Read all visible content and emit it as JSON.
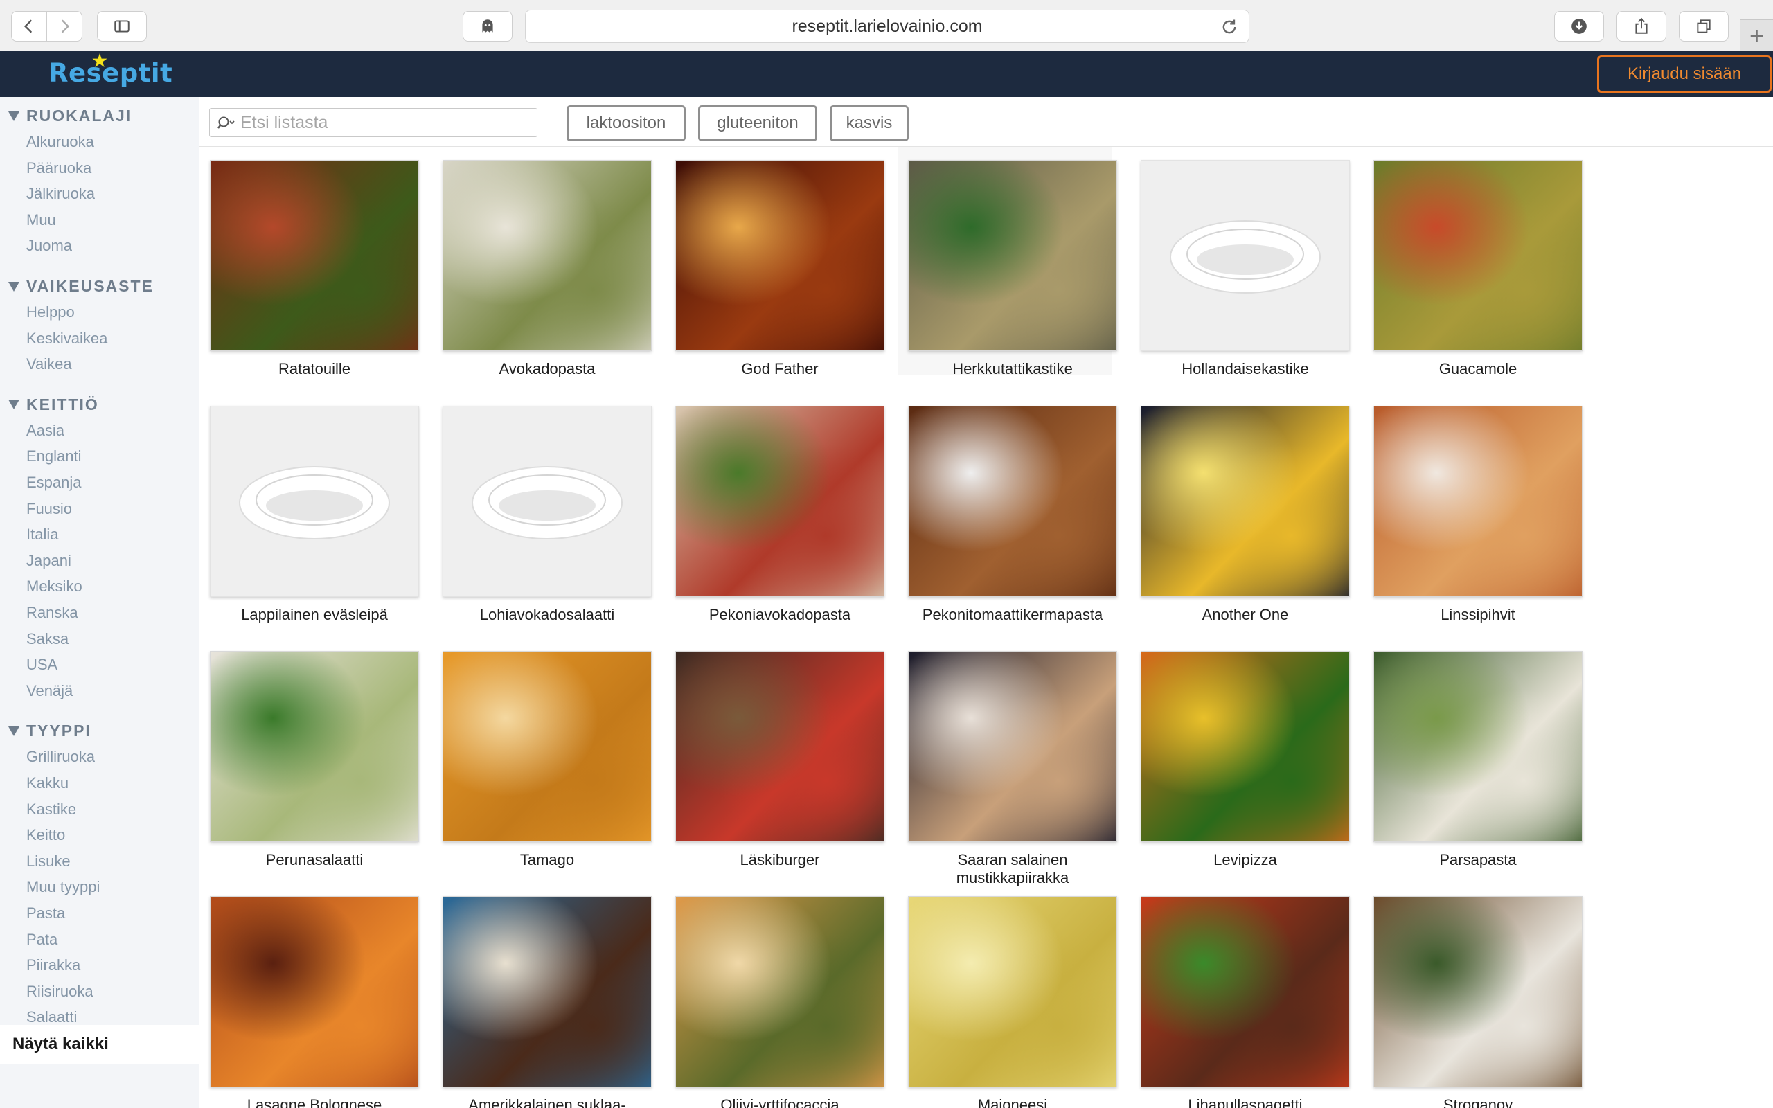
{
  "browser": {
    "url": "reseptit.larielovainio.com"
  },
  "site": {
    "logo_text": "Reseptit",
    "login_label": "Kirjaudu sisään"
  },
  "sidebar": {
    "categories": [
      {
        "heading": "RUOKALAJI",
        "items": [
          "Alkuruoka",
          "Pääruoka",
          "Jälkiruoka",
          "Muu",
          "Juoma"
        ]
      },
      {
        "heading": "VAIKEUSASTE",
        "items": [
          "Helppo",
          "Keskivaikea",
          "Vaikea"
        ]
      },
      {
        "heading": "KEITTIÖ",
        "items": [
          "Aasia",
          "Englanti",
          "Espanja",
          "Fuusio",
          "Italia",
          "Japani",
          "Meksiko",
          "Ranska",
          "Saksa",
          "USA",
          "Venäjä"
        ]
      },
      {
        "heading": "TYYPPI",
        "items": [
          "Grilliruoka",
          "Kakku",
          "Kastike",
          "Keitto",
          "Lisuke",
          "Muu tyyppi",
          "Pasta",
          "Pata",
          "Piirakka",
          "Riisiruoka",
          "Salaatti"
        ]
      }
    ],
    "show_all": "Näytä kaikki"
  },
  "filters": {
    "search_placeholder": "Etsi listasta",
    "tags": [
      "laktoositon",
      "gluteeniton",
      "kasvis"
    ]
  },
  "recipes": [
    {
      "name": "Ratatouille",
      "image": "photo",
      "colors": [
        "#7a2a14",
        "#3d5a1a",
        "#b4482a"
      ]
    },
    {
      "name": "Avokadopasta",
      "image": "photo",
      "colors": [
        "#d9d6c8",
        "#7e8b4a",
        "#e8e4d8"
      ]
    },
    {
      "name": "God Father",
      "image": "photo",
      "colors": [
        "#3b0c06",
        "#9a3a10",
        "#e8a84a"
      ]
    },
    {
      "name": "Herkkutattikastike",
      "image": "photo",
      "colors": [
        "#5b5a46",
        "#a99a6a",
        "#2e6b2a"
      ]
    },
    {
      "name": "Hollandaisekastike",
      "image": "placeholder",
      "colors": []
    },
    {
      "name": "Guacamole",
      "image": "photo",
      "colors": [
        "#6b7a2a",
        "#a99a3a",
        "#c84a2a"
      ]
    },
    {
      "name": "Lappilainen eväsleipä",
      "image": "placeholder",
      "colors": []
    },
    {
      "name": "Lohiavokadosalaatti",
      "image": "placeholder",
      "colors": []
    },
    {
      "name": "Pekoniavokadopasta",
      "image": "photo",
      "colors": [
        "#d8c8b0",
        "#b03a2a",
        "#4a7a2a"
      ]
    },
    {
      "name": "Pekonitomaattikermapasta",
      "image": "photo",
      "colors": [
        "#5a2a12",
        "#a06030",
        "#efefef"
      ]
    },
    {
      "name": "Another One",
      "image": "photo",
      "colors": [
        "#161a2e",
        "#e8b82a",
        "#f4e070"
      ]
    },
    {
      "name": "Linssipihvit",
      "image": "photo",
      "colors": [
        "#b85a2a",
        "#e0a060",
        "#f0e8e0"
      ]
    },
    {
      "name": "Perunasalaatti",
      "image": "photo",
      "colors": [
        "#e8e4dc",
        "#a8b87a",
        "#3a7a2a"
      ]
    },
    {
      "name": "Tamago",
      "image": "photo",
      "colors": [
        "#e89a2a",
        "#c47a1a",
        "#f4d8a0"
      ]
    },
    {
      "name": "Läskiburger",
      "image": "photo",
      "colors": [
        "#3a2a22",
        "#c8382a",
        "#7a5a3a"
      ]
    },
    {
      "name": "Saaran salainen mustikkapiirakka",
      "image": "photo",
      "colors": [
        "#1a1a2a",
        "#c8a07a",
        "#e8e0d8"
      ]
    },
    {
      "name": "Levipizza",
      "image": "photo",
      "colors": [
        "#d86a1a",
        "#2a6a1a",
        "#e8c02a"
      ]
    },
    {
      "name": "Parsapasta",
      "image": "photo",
      "colors": [
        "#3a5a2a",
        "#e8e4d8",
        "#7a9a4a"
      ]
    },
    {
      "name": "Lasagne Bolognese",
      "image": "photo",
      "colors": [
        "#b04a1a",
        "#e8862a",
        "#5a2010"
      ]
    },
    {
      "name": "Amerikkalainen suklaa-",
      "image": "photo",
      "colors": [
        "#2a6a9a",
        "#4a2a1a",
        "#e8e0d0"
      ]
    },
    {
      "name": "Oliivi-yrttifocaccia",
      "image": "photo",
      "colors": [
        "#e09a4a",
        "#5a6a2a",
        "#f0d8a8"
      ]
    },
    {
      "name": "Majoneesi",
      "image": "photo",
      "colors": [
        "#e8d878",
        "#c8b040",
        "#f4ecb0"
      ]
    },
    {
      "name": "Lihapullaspagetti",
      "image": "photo",
      "colors": [
        "#c83a1a",
        "#5a2a1a",
        "#3a8a2a"
      ]
    },
    {
      "name": "Stroganov",
      "image": "photo",
      "colors": [
        "#6a4a2a",
        "#e8e4dc",
        "#3a5a2a"
      ]
    }
  ]
}
